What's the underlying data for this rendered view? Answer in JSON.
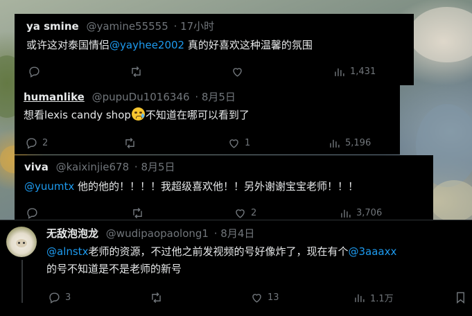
{
  "replies": [
    {
      "name": "ya smine",
      "handle": "@yamine55555",
      "time": "· 17小时",
      "text_before": "或许这对泰国情侣",
      "mention": "@yayhee2002",
      "text_after": " 真的好喜欢这种温馨的氛围",
      "replies": "",
      "reposts": "",
      "likes": "",
      "views": "1,431"
    },
    {
      "name": "humanlike",
      "handle": "@pupuDu1016346",
      "time": "· 8月5日",
      "text_before": "想看lexis candy shop",
      "emoji": "crying-smile-emoji",
      "text_after": "不知道在哪可以看到了",
      "replies": "2",
      "reposts": "",
      "likes": "1",
      "views": "5,196"
    },
    {
      "name": "viva",
      "handle": "@kaixinjie678",
      "time": "· 8月5日",
      "mention": "@yuumtx",
      "text_after": " 他的他的！！！！我超级喜欢他！！另外谢谢宝宝老师！！！",
      "replies": "",
      "reposts": "",
      "likes": "2",
      "views": "3,706"
    },
    {
      "name": "无敌泡泡龙",
      "handle": "@wudipaopaolong1",
      "time": "· 8月4日",
      "mention": "@alnstx",
      "line1_text": "老师的资源，不过他之前发视频的号好像炸了，现在有个",
      "mention2": "@3aaaxx",
      "line2": "的号不知道是不是老师的新号",
      "replies": "3",
      "reposts": "",
      "likes": "13",
      "views": "1.1万"
    }
  ],
  "icons": [
    "reply-icon",
    "repost-icon",
    "like-icon",
    "views-icon",
    "bookmark-icon"
  ],
  "colors": {
    "card": "#000000",
    "text": "#e7e9ea",
    "muted": "#71767b",
    "link": "#1d9bf0"
  }
}
